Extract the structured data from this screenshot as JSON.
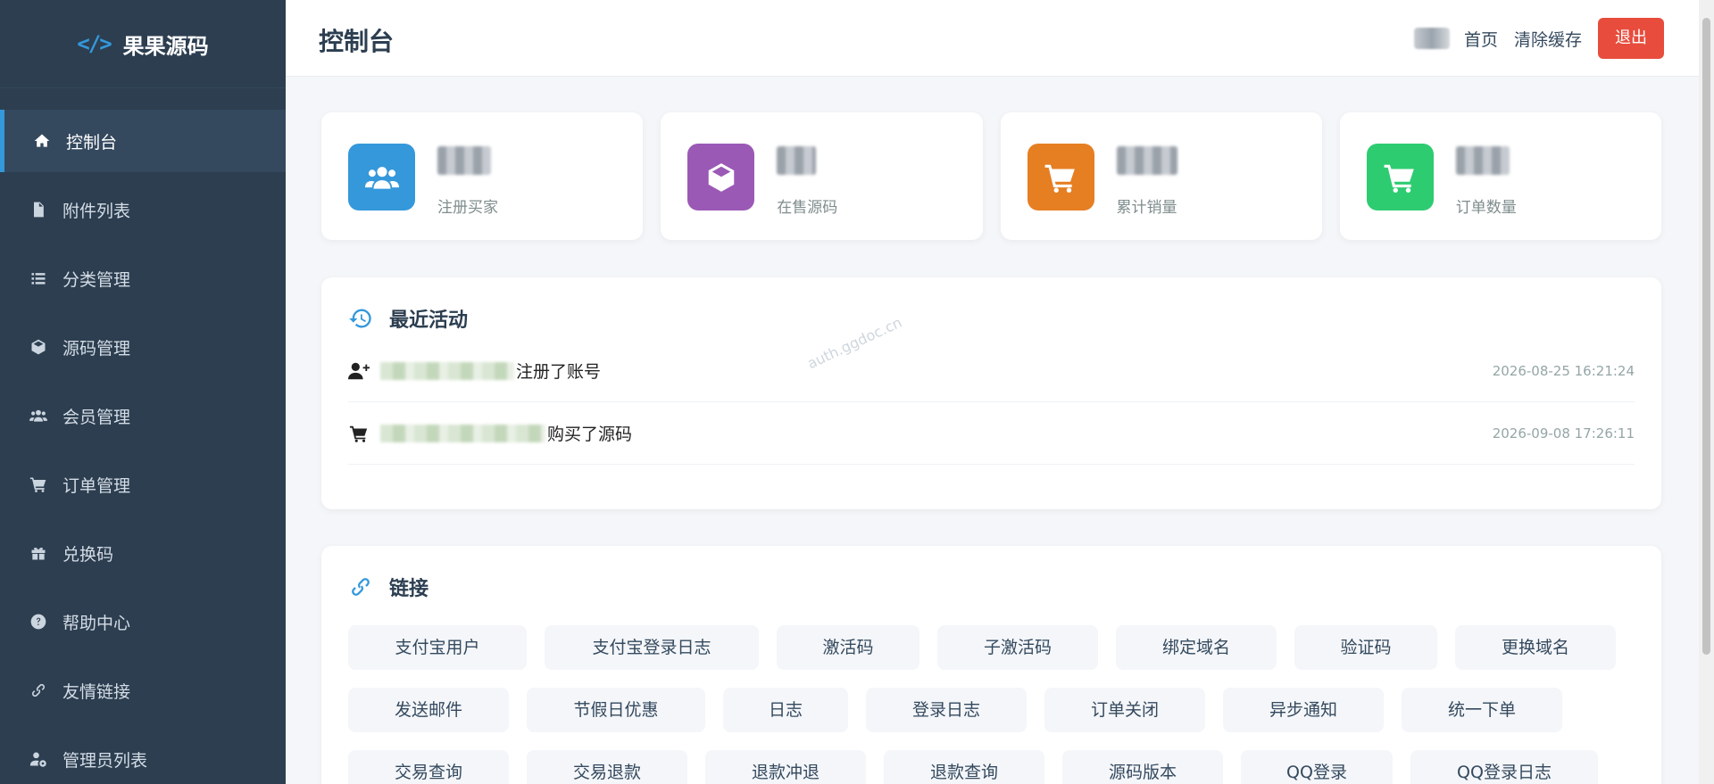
{
  "brand": {
    "icon": "</>",
    "name": "果果源码"
  },
  "sidebar": {
    "items": [
      {
        "label": "控制台",
        "icon": "home-icon",
        "active": true
      },
      {
        "label": "附件列表",
        "icon": "file-icon"
      },
      {
        "label": "分类管理",
        "icon": "list-icon"
      },
      {
        "label": "源码管理",
        "icon": "cube-icon"
      },
      {
        "label": "会员管理",
        "icon": "users-icon"
      },
      {
        "label": "订单管理",
        "icon": "cart-icon"
      },
      {
        "label": "兑换码",
        "icon": "gift-icon"
      },
      {
        "label": "帮助中心",
        "icon": "question-icon"
      },
      {
        "label": "友情链接",
        "icon": "link-icon"
      },
      {
        "label": "管理员列表",
        "icon": "user-gear-icon"
      }
    ]
  },
  "header": {
    "title": "控制台",
    "home_label": "首页",
    "clear_cache_label": "清除缓存",
    "logout_label": "退出"
  },
  "stats": [
    {
      "label": "注册买家",
      "icon": "users-icon",
      "color": "#3498db"
    },
    {
      "label": "在售源码",
      "icon": "box-icon",
      "color": "#9b59b6"
    },
    {
      "label": "累计销量",
      "icon": "cart-icon",
      "color": "#e67e22"
    },
    {
      "label": "订单数量",
      "icon": "cart-icon",
      "color": "#2ecc71"
    }
  ],
  "activity": {
    "title": "最近活动",
    "items": [
      {
        "icon": "user-plus-icon",
        "text": "注册了账号",
        "time": "2026-08-25 16:21:24"
      },
      {
        "icon": "cart-icon",
        "text": "购买了源码",
        "time": "2026-09-08 17:26:11"
      }
    ]
  },
  "links": {
    "title": "链接",
    "rows": [
      [
        "支付宝用户",
        "支付宝登录日志",
        "激活码",
        "子激活码",
        "绑定域名",
        "验证码",
        "更换域名"
      ],
      [
        "发送邮件",
        "节假日优惠",
        "日志",
        "登录日志",
        "订单关闭",
        "异步通知",
        "统一下单"
      ],
      [
        "交易查询",
        "交易退款",
        "退款冲退",
        "退款查询",
        "源码版本",
        "QQ登录",
        "QQ登录日志"
      ]
    ]
  },
  "watermark": "auth.ggdoc.cn",
  "colors": {
    "sidebar": "#2c3e50",
    "accent": "#3498db",
    "logout": "#e74c3c"
  }
}
